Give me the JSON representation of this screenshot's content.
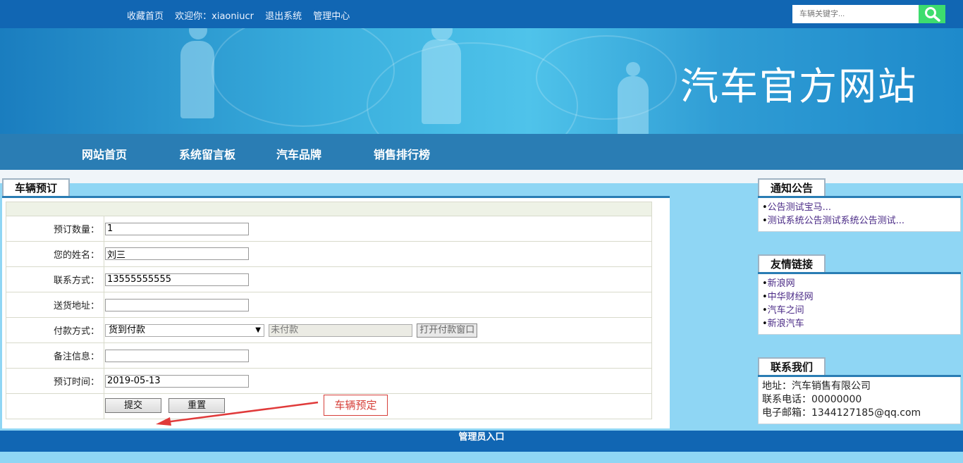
{
  "topbar": {
    "links": [
      "收藏首页",
      "欢迎你：xiaoniucr",
      "退出系统",
      "管理中心"
    ],
    "search_placeholder": "车辆关键字..."
  },
  "banner": {
    "title": "汽车官方网站"
  },
  "nav": {
    "items": [
      "网站首页",
      "系统留言板",
      "汽车品牌",
      "销售排行榜"
    ]
  },
  "main": {
    "tab_title": "车辆预订",
    "form": {
      "quantity_label": "预订数量：",
      "quantity_value": "1",
      "name_label": "您的姓名：",
      "name_value": "刘三",
      "contact_label": "联系方式：",
      "contact_value": "13555555555",
      "address_label": "送货地址：",
      "address_value": "",
      "payment_label": "付款方式：",
      "payment_selected": "货到付款",
      "payment_status": "未付款",
      "open_payment_button": "打开付款窗口",
      "remark_label": "备注信息：",
      "remark_value": "",
      "time_label": "预订时间：",
      "time_value": "2019-05-13",
      "submit_button": "提交",
      "reset_button": "重置"
    },
    "annotation": "车辆预定"
  },
  "sidebar": {
    "notice": {
      "title": "通知公告",
      "items": [
        "公告测试宝马...",
        "测试系统公告测试系统公告测试..."
      ]
    },
    "links": {
      "title": "友情链接",
      "items": [
        "新浪网",
        "中华财经网",
        "汽车之间",
        "新浪汽车"
      ]
    },
    "contact": {
      "title": "联系我们",
      "address": "地址：汽车销售有限公司",
      "phone": "联系电话：00000000",
      "email": "电子邮箱：1344127185@qq.com"
    }
  },
  "footer": {
    "admin_link": "管理员入口"
  },
  "colors": {
    "topbar": "#1166b3",
    "nav": "#2a7db4",
    "background": "#8fd6f4",
    "search_button": "#3ddc6e",
    "annotation": "#d6403a"
  }
}
